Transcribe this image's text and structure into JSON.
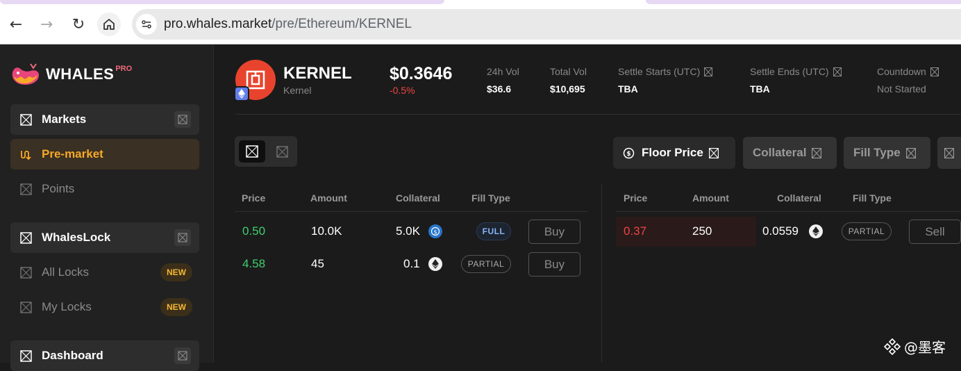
{
  "browser": {
    "back_icon": "←",
    "forward_icon": "→",
    "reload_icon": "↻",
    "url_domain": "pro.whales.market",
    "url_path": "/pre/Ethereum/KERNEL"
  },
  "sidebar": {
    "logo_text": "WHALES",
    "logo_pro": "PRO",
    "items": [
      {
        "label": "Markets"
      },
      {
        "label": "Pre-market"
      },
      {
        "label": "Points"
      },
      {
        "label": "WhalesLock"
      },
      {
        "label": "All Locks",
        "badge": "NEW"
      },
      {
        "label": "My Locks",
        "badge": "NEW"
      },
      {
        "label": "Dashboard"
      }
    ]
  },
  "header": {
    "token_symbol": "KERNEL",
    "token_name": "Kernel",
    "price": "$0.3646",
    "change": "-0.5%",
    "stats": [
      {
        "label": "24h Vol",
        "value": "$36.6"
      },
      {
        "label": "Total Vol",
        "value": "$10,695"
      },
      {
        "label": "Settle Starts (UTC)",
        "value": "TBA"
      },
      {
        "label": "Settle Ends (UTC)",
        "value": "TBA"
      },
      {
        "label": "Countdown",
        "value": "Not Started"
      }
    ]
  },
  "filters": {
    "floor_price": "Floor Price",
    "collateral": "Collateral",
    "fill_type": "Fill Type"
  },
  "columns": [
    "Price",
    "Amount",
    "Collateral",
    "Fill Type"
  ],
  "buy_orders": [
    {
      "price": "0.50",
      "amount": "10.0K",
      "collateral": "5.0K",
      "coin": "usdc",
      "fill": "FULL",
      "action": "Buy"
    },
    {
      "price": "4.58",
      "amount": "45",
      "collateral": "0.1",
      "coin": "eth",
      "fill": "PARTIAL",
      "action": "Buy"
    }
  ],
  "sell_orders": [
    {
      "price": "0.37",
      "amount": "250",
      "collateral": "0.0559",
      "coin": "eth",
      "fill": "PARTIAL",
      "action": "Sell"
    }
  ],
  "watermark": "@墨客",
  "colors": {
    "accent": "#f7a928",
    "buy": "#3ecf6e",
    "sell": "#ef4444"
  }
}
